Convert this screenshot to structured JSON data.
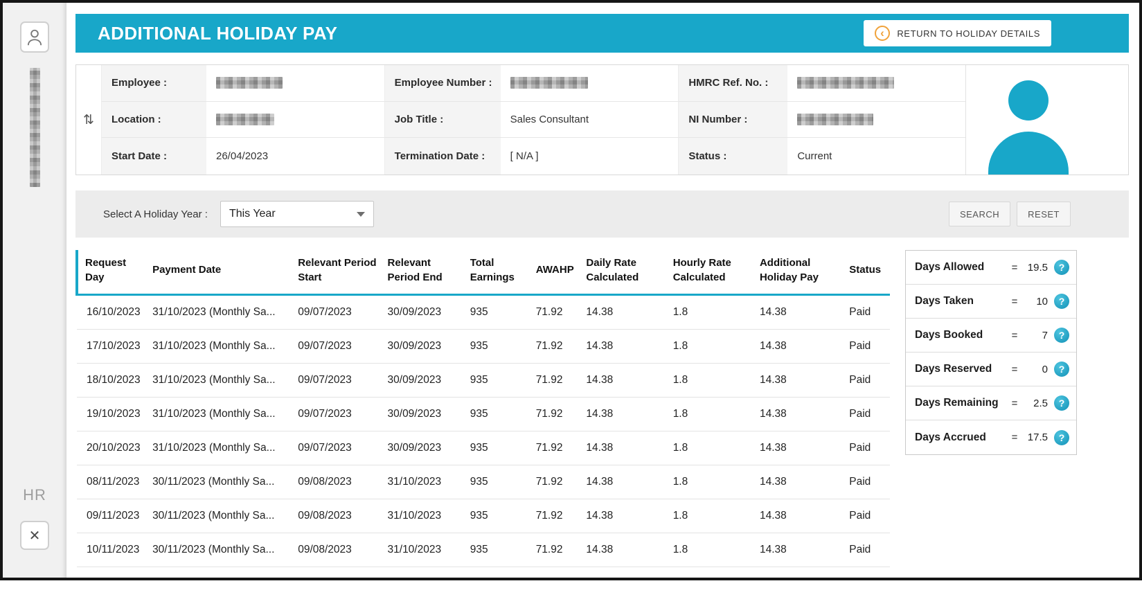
{
  "colors": {
    "accent_teal": "#18a7c9",
    "accent_orange": "#f0a23a"
  },
  "icons": {
    "close": "✕",
    "back_chevron": "‹",
    "sort": "⇅",
    "help": "?"
  },
  "sidebar": {
    "hr_label": "HR"
  },
  "header": {
    "title": "ADDITIONAL HOLIDAY PAY",
    "return_button_label": "RETURN TO HOLIDAY DETAILS"
  },
  "employee": {
    "fields": [
      {
        "label": "Employee :",
        "value": "",
        "redacted": true
      },
      {
        "label": "Employee Number :",
        "value": "",
        "redacted": true
      },
      {
        "label": "HMRC Ref. No. :",
        "value": "",
        "redacted": true
      },
      {
        "label": "Location :",
        "value": "",
        "redacted": true
      },
      {
        "label": "Job Title :",
        "value": "Sales Consultant",
        "redacted": false
      },
      {
        "label": "NI Number :",
        "value": "",
        "redacted": true
      },
      {
        "label": "Start Date :",
        "value": "26/04/2023",
        "redacted": false
      },
      {
        "label": "Termination Date :",
        "value": "[ N/A ]",
        "redacted": false
      },
      {
        "label": "Status :",
        "value": "Current",
        "redacted": false
      }
    ]
  },
  "filter": {
    "label": "Select A Holiday Year :",
    "selected_option": "This Year",
    "search_label": "SEARCH",
    "reset_label": "RESET"
  },
  "table": {
    "columns": [
      "Request Day",
      "Payment Date",
      "Relevant Period Start",
      "Relevant Period End",
      "Total Earnings",
      "AWAHP",
      "Daily Rate Calculated",
      "Hourly Rate Calculated",
      "Additional Holiday Pay",
      "Status"
    ],
    "rows": [
      {
        "request_day": "16/10/2023",
        "payment_date": "31/10/2023 (Monthly Sa...",
        "period_start": "09/07/2023",
        "period_end": "30/09/2023",
        "total_earnings": "935",
        "awahp": "71.92",
        "daily_rate": "14.38",
        "hourly_rate": "1.8",
        "additional_holiday_pay": "14.38",
        "status": "Paid"
      },
      {
        "request_day": "17/10/2023",
        "payment_date": "31/10/2023 (Monthly Sa...",
        "period_start": "09/07/2023",
        "period_end": "30/09/2023",
        "total_earnings": "935",
        "awahp": "71.92",
        "daily_rate": "14.38",
        "hourly_rate": "1.8",
        "additional_holiday_pay": "14.38",
        "status": "Paid"
      },
      {
        "request_day": "18/10/2023",
        "payment_date": "31/10/2023 (Monthly Sa...",
        "period_start": "09/07/2023",
        "period_end": "30/09/2023",
        "total_earnings": "935",
        "awahp": "71.92",
        "daily_rate": "14.38",
        "hourly_rate": "1.8",
        "additional_holiday_pay": "14.38",
        "status": "Paid"
      },
      {
        "request_day": "19/10/2023",
        "payment_date": "31/10/2023 (Monthly Sa...",
        "period_start": "09/07/2023",
        "period_end": "30/09/2023",
        "total_earnings": "935",
        "awahp": "71.92",
        "daily_rate": "14.38",
        "hourly_rate": "1.8",
        "additional_holiday_pay": "14.38",
        "status": "Paid"
      },
      {
        "request_day": "20/10/2023",
        "payment_date": "31/10/2023 (Monthly Sa...",
        "period_start": "09/07/2023",
        "period_end": "30/09/2023",
        "total_earnings": "935",
        "awahp": "71.92",
        "daily_rate": "14.38",
        "hourly_rate": "1.8",
        "additional_holiday_pay": "14.38",
        "status": "Paid"
      },
      {
        "request_day": "08/11/2023",
        "payment_date": "30/11/2023 (Monthly Sa...",
        "period_start": "09/08/2023",
        "period_end": "31/10/2023",
        "total_earnings": "935",
        "awahp": "71.92",
        "daily_rate": "14.38",
        "hourly_rate": "1.8",
        "additional_holiday_pay": "14.38",
        "status": "Paid"
      },
      {
        "request_day": "09/11/2023",
        "payment_date": "30/11/2023 (Monthly Sa...",
        "period_start": "09/08/2023",
        "period_end": "31/10/2023",
        "total_earnings": "935",
        "awahp": "71.92",
        "daily_rate": "14.38",
        "hourly_rate": "1.8",
        "additional_holiday_pay": "14.38",
        "status": "Paid"
      },
      {
        "request_day": "10/11/2023",
        "payment_date": "30/11/2023 (Monthly Sa...",
        "period_start": "09/08/2023",
        "period_end": "31/10/2023",
        "total_earnings": "935",
        "awahp": "71.92",
        "daily_rate": "14.38",
        "hourly_rate": "1.8",
        "additional_holiday_pay": "14.38",
        "status": "Paid"
      }
    ]
  },
  "summary": {
    "eq_sign": "=",
    "items": [
      {
        "label": "Days Allowed",
        "value": "19.5"
      },
      {
        "label": "Days Taken",
        "value": "10"
      },
      {
        "label": "Days Booked",
        "value": "7"
      },
      {
        "label": "Days Reserved",
        "value": "0"
      },
      {
        "label": "Days Remaining",
        "value": "2.5"
      },
      {
        "label": "Days Accrued",
        "value": "17.5"
      }
    ]
  }
}
